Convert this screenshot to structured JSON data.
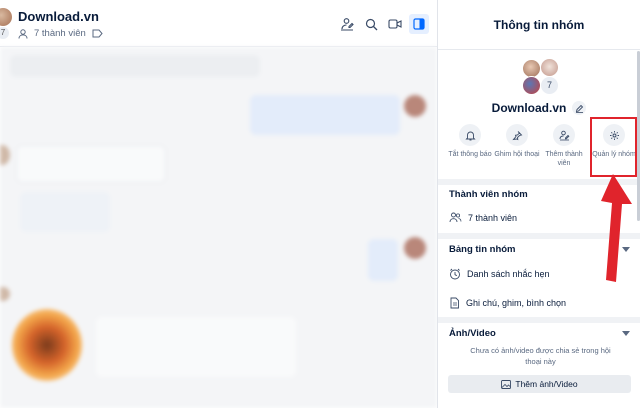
{
  "chat": {
    "group_count": "7",
    "title": "Download.vn",
    "member_count": "7 thành viên",
    "icons": [
      "add-member-icon",
      "search-icon",
      "video-call-icon",
      "sidebar-toggle-icon"
    ]
  },
  "panel": {
    "title": "Thông tin nhóm",
    "avatar_overflow": "7",
    "group_name": "Download.vn",
    "actions": [
      {
        "label": "Tắt thông báo",
        "icon": "bell-icon"
      },
      {
        "label": "Ghim hội thoại",
        "icon": "pin-icon"
      },
      {
        "label": "Thêm thành viên",
        "icon": "add-member-icon"
      },
      {
        "label": "Quản lý nhóm",
        "icon": "gear-icon"
      }
    ],
    "members_section": {
      "title": "Thành viên nhóm",
      "row": "7 thành viên"
    },
    "board_section": {
      "title": "Bảng tin nhóm",
      "rows": [
        "Danh sách nhắc hẹn",
        "Ghi chú, ghim, bình chọn"
      ]
    },
    "media_section": {
      "title": "Ảnh/Video",
      "empty_note": "Chưa có ảnh/video được chia sẻ trong hội thoại này",
      "button": "Thêm ảnh/Video"
    }
  },
  "colors": {
    "accent": "#0068ff",
    "annotation": "#e0242c",
    "text": "#081b3a",
    "muted": "#5a6981"
  }
}
